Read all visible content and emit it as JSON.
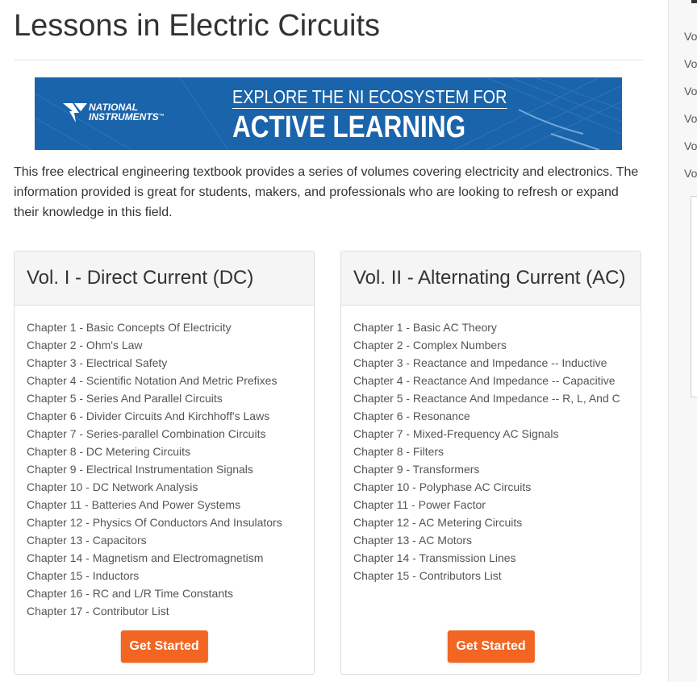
{
  "page": {
    "title": "Lessons in Electric Circuits",
    "intro": "This free electrical engineering textbook provides a series of volumes covering electricity and electronics. The information provided is great for students, makers, and professionals who are looking to refresh or expand their knowledge in this field."
  },
  "banner": {
    "logo_line1": "NATIONAL",
    "logo_line2": "INSTRUMENTS",
    "logo_tm": "™",
    "line1": "EXPLORE THE NI ECOSYSTEM FOR",
    "line2": "ACTIVE LEARNING",
    "background_color": "#1a64ab"
  },
  "volumes": [
    {
      "title": "Vol. I - Direct Current (DC)",
      "chapters": [
        "Chapter 1 - Basic Concepts Of Electricity",
        "Chapter 2 - Ohm's Law",
        "Chapter 3 - Electrical Safety",
        "Chapter 4 - Scientific Notation And Metric Prefixes",
        "Chapter 5 - Series And Parallel Circuits",
        "Chapter 6 - Divider Circuits And Kirchhoff's Laws",
        "Chapter 7 - Series-parallel Combination Circuits",
        "Chapter 8 - DC Metering Circuits",
        "Chapter 9 - Electrical Instrumentation Signals",
        "Chapter 10 - DC Network Analysis",
        "Chapter 11 - Batteries And Power Systems",
        "Chapter 12 - Physics Of Conductors And Insulators",
        "Chapter 13 - Capacitors",
        "Chapter 14 - Magnetism and Electromagnetism",
        "Chapter 15 - Inductors",
        "Chapter 16 - RC and L/R Time Constants",
        "Chapter 17 - Contributor List"
      ],
      "button_label": "Get Started"
    },
    {
      "title": "Vol. II - Alternating Current (AC)",
      "chapters": [
        "Chapter 1 - Basic AC Theory",
        "Chapter 2 - Complex Numbers",
        "Chapter 3 - Reactance and Impedance -- Inductive",
        "Chapter 4 - Reactance And Impedance -- Capacitive",
        "Chapter 5 - Reactance And Impedance -- R, L, And C",
        "Chapter 6 - Resonance",
        "Chapter 7 - Mixed-Frequency AC Signals",
        "Chapter 8 - Filters",
        "Chapter 9 - Transformers",
        "Chapter 10 - Polyphase AC Circuits",
        "Chapter 11 - Power Factor",
        "Chapter 12 - AC Metering Circuits",
        "Chapter 13 - AC Motors",
        "Chapter 14 - Transmission Lines",
        "Chapter 15 - Contributors List"
      ],
      "button_label": "Get Started"
    }
  ],
  "sidebar": {
    "items": [
      "Vo",
      "Vo",
      "Vo",
      "Vo",
      "Vo",
      "Vo"
    ]
  },
  "colors": {
    "accent_button": "#f26522",
    "text": "#333333",
    "link": "#555555"
  }
}
